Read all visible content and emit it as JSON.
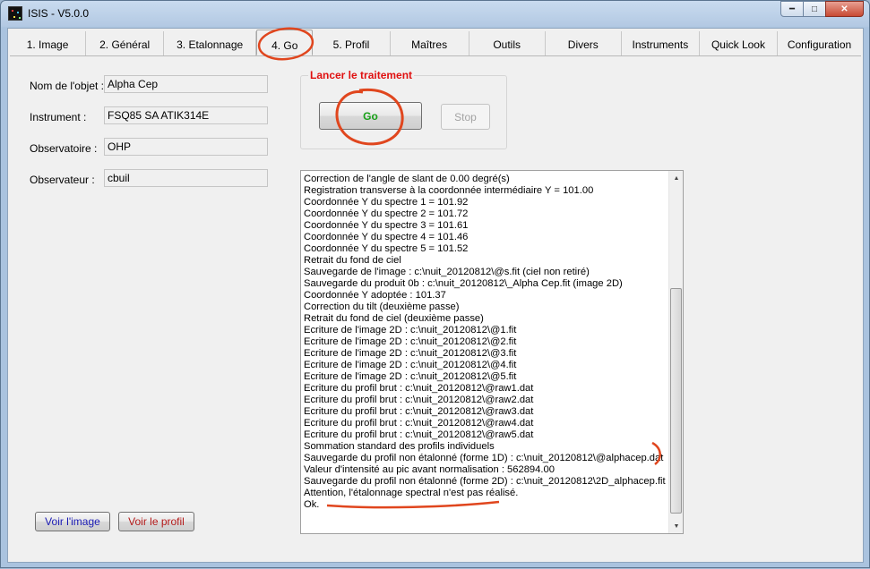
{
  "window": {
    "title": "ISIS - V5.0.0"
  },
  "tabs": [
    {
      "label": "1. Image"
    },
    {
      "label": "2. Général"
    },
    {
      "label": "3. Etalonnage"
    },
    {
      "label": "4. Go"
    },
    {
      "label": "5. Profil"
    },
    {
      "label": "Maîtres"
    },
    {
      "label": "Outils"
    },
    {
      "label": "Divers"
    },
    {
      "label": "Instruments"
    },
    {
      "label": "Quick Look"
    },
    {
      "label": "Configuration"
    }
  ],
  "active_tab": "4. Go",
  "fields": {
    "object": {
      "label": "Nom de l'objet :",
      "value": "Alpha Cep"
    },
    "instrument": {
      "label": "Instrument :",
      "value": "FSQ85 SA ATIK314E"
    },
    "observatory": {
      "label": "Observatoire :",
      "value": "OHP"
    },
    "observer": {
      "label": "Observateur :",
      "value": "cbuil"
    }
  },
  "processing": {
    "group_title": "Lancer le traitement",
    "go_label": "Go",
    "stop_label": "Stop"
  },
  "buttons": {
    "view_image": "Voir l'image",
    "view_profile": "Voir le profil"
  },
  "log": [
    "Correction de l'angle de slant de 0.00 degré(s)",
    "Registration transverse à la coordonnée intermédiaire Y = 101.00",
    "Coordonnée Y du spectre 1 = 101.92",
    "Coordonnée Y du spectre 2 = 101.72",
    "Coordonnée Y du spectre 3 = 101.61",
    "Coordonnée Y du spectre 4 = 101.46",
    "Coordonnée Y du spectre 5 = 101.52",
    "Retrait du fond de ciel",
    "Sauvegarde de l'image : c:\\nuit_20120812\\@s.fit (ciel non retiré)",
    "Sauvegarde du produit 0b : c:\\nuit_20120812\\_Alpha Cep.fit (image 2D)",
    "Coordonnée Y adoptée : 101.37",
    "Correction du tilt (deuxième passe)",
    "Retrait du fond de ciel (deuxième passe)",
    "Ecriture de l'image 2D : c:\\nuit_20120812\\@1.fit",
    "Ecriture de l'image 2D : c:\\nuit_20120812\\@2.fit",
    "Ecriture de l'image 2D : c:\\nuit_20120812\\@3.fit",
    "Ecriture de l'image 2D : c:\\nuit_20120812\\@4.fit",
    "Ecriture de l'image 2D : c:\\nuit_20120812\\@5.fit",
    "Ecriture du profil brut : c:\\nuit_20120812\\@raw1.dat",
    "Ecriture du profil brut : c:\\nuit_20120812\\@raw2.dat",
    "Ecriture du profil brut : c:\\nuit_20120812\\@raw3.dat",
    "Ecriture du profil brut : c:\\nuit_20120812\\@raw4.dat",
    "Ecriture du profil brut : c:\\nuit_20120812\\@raw5.dat",
    "Sommation standard des profils individuels",
    "Sauvegarde du profil non étalonné (forme 1D) : c:\\nuit_20120812\\@alphacep.dat",
    "Valeur d'intensité au pic avant normalisation : 562894.00",
    "Sauvegarde du profil non étalonné (forme 2D) : c:\\nuit_20120812\\2D_alphacep.fit",
    "Attention, l'étalonnage spectral n'est pas réalisé.",
    "Ok."
  ],
  "colors": {
    "annotation": "#e0461e",
    "group_title": "#e01010",
    "go_text": "#18a018"
  },
  "icons": {
    "app": "isis-app-icon",
    "minimize": "minimize-icon",
    "maximize": "maximize-icon",
    "close": "close-icon"
  }
}
